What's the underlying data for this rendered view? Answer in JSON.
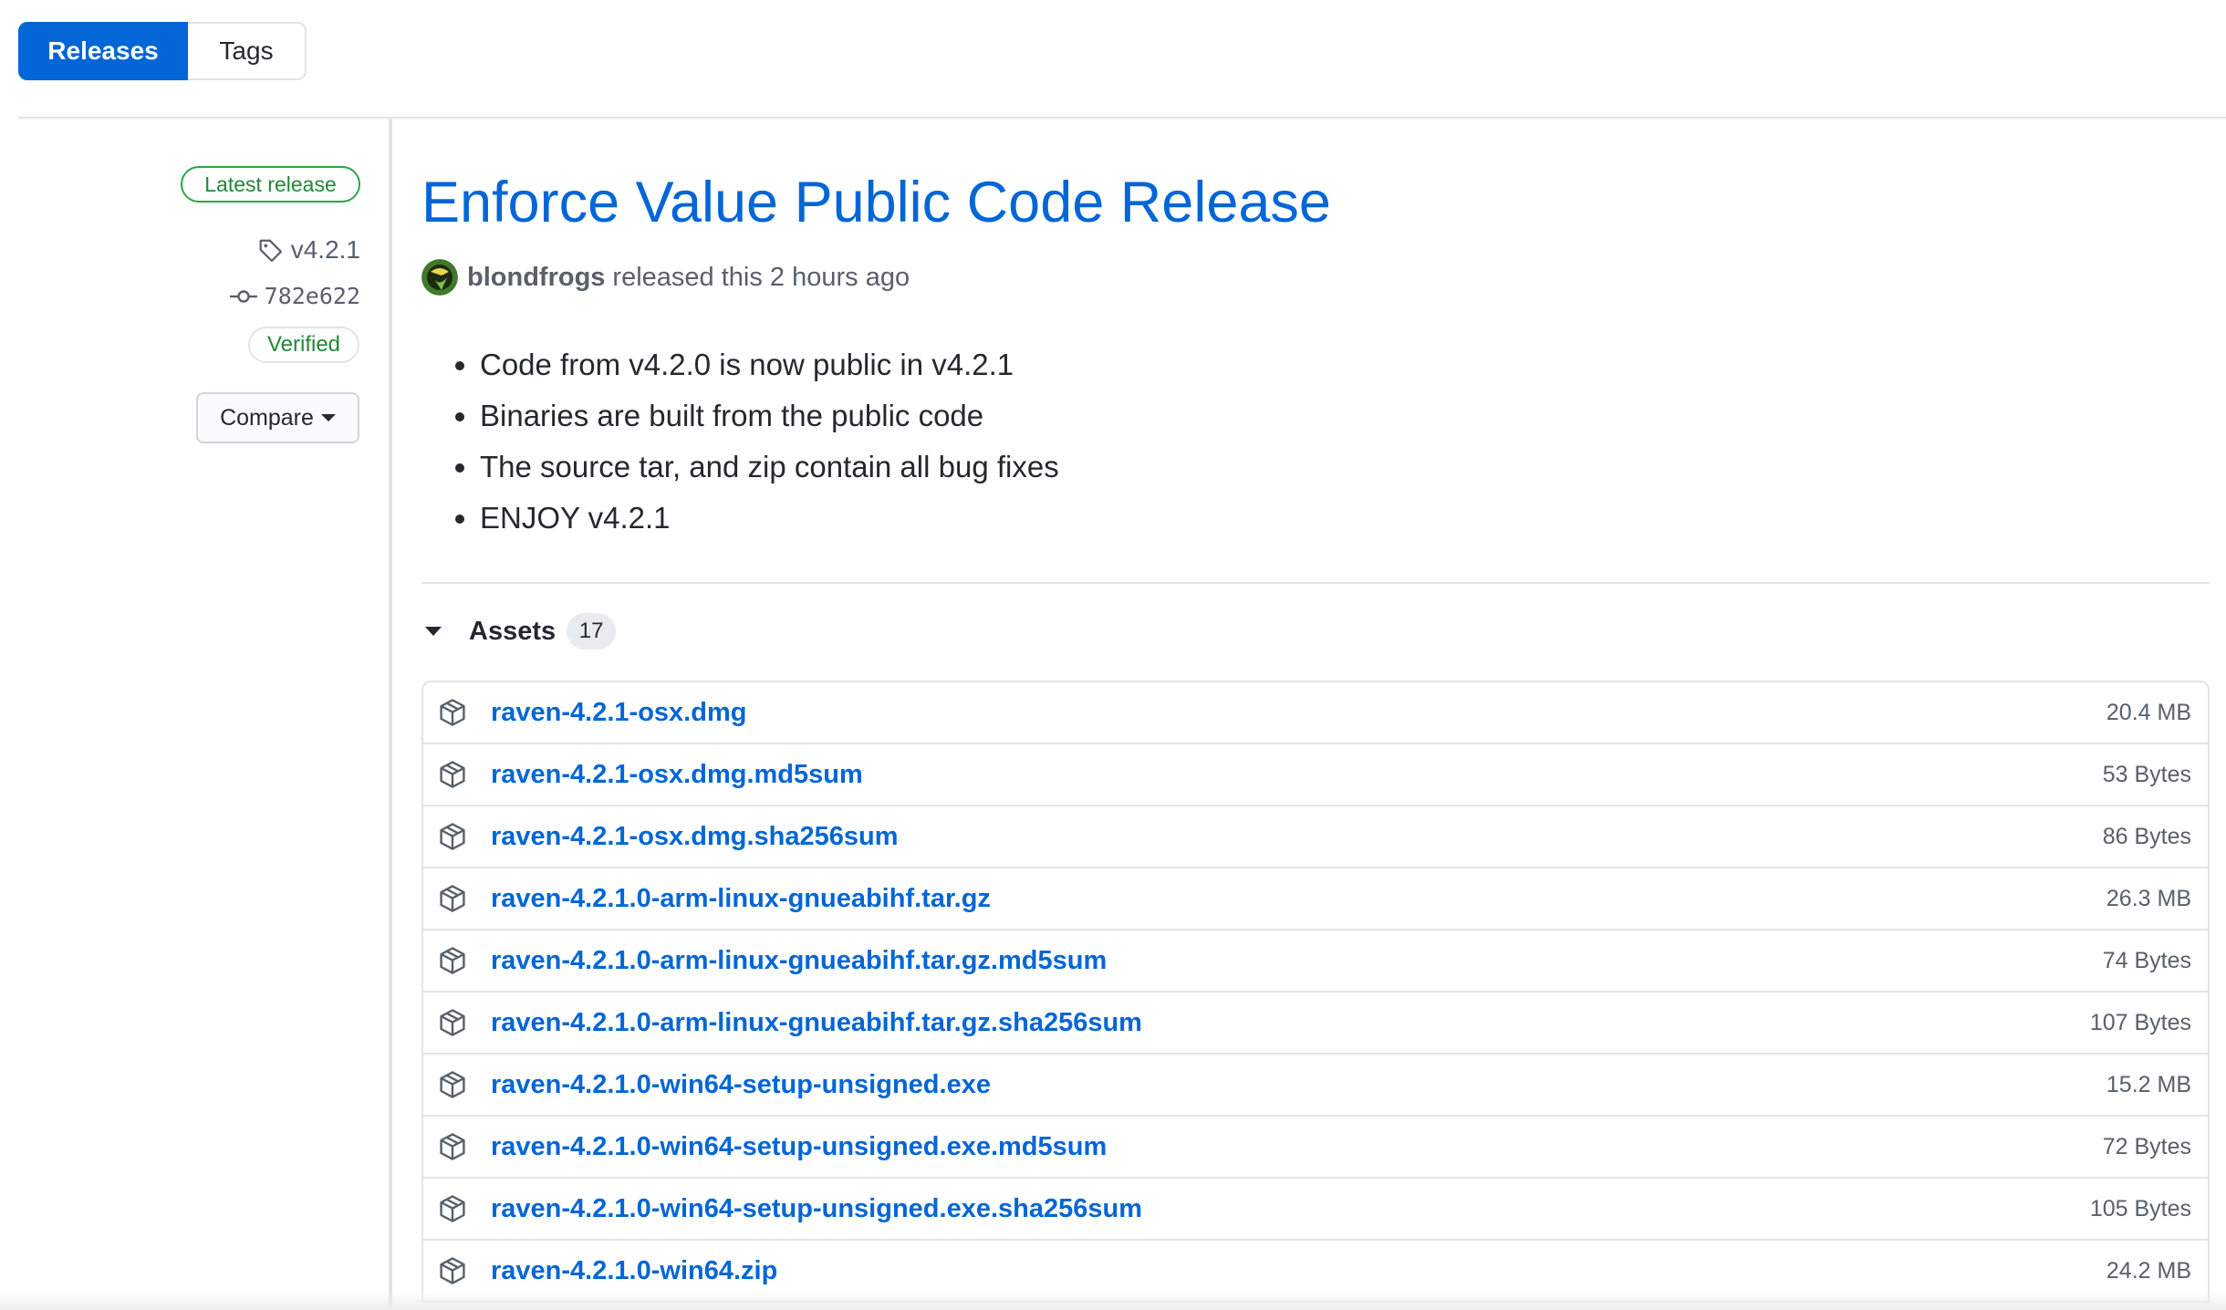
{
  "tabs": [
    {
      "label": "Releases",
      "active": true
    },
    {
      "label": "Tags",
      "active": false
    }
  ],
  "sidebar": {
    "latest_badge": "Latest release",
    "tag": "v4.2.1",
    "commit": "782e622",
    "verified": "Verified",
    "compare_label": "Compare"
  },
  "release": {
    "title": "Enforce Value Public Code Release",
    "author": "blondfrogs",
    "released_text": "released this 2 hours ago",
    "notes": [
      "Code from v4.2.0 is now public in v4.2.1",
      "Binaries are built from the public code",
      "The source tar, and zip contain all bug fixes",
      "ENJOY v4.2.1"
    ]
  },
  "assets": {
    "label": "Assets",
    "count": "17",
    "items": [
      {
        "name": "raven-4.2.1-osx.dmg",
        "size": "20.4 MB"
      },
      {
        "name": "raven-4.2.1-osx.dmg.md5sum",
        "size": "53 Bytes"
      },
      {
        "name": "raven-4.2.1-osx.dmg.sha256sum",
        "size": "86 Bytes"
      },
      {
        "name": "raven-4.2.1.0-arm-linux-gnueabihf.tar.gz",
        "size": "26.3 MB"
      },
      {
        "name": "raven-4.2.1.0-arm-linux-gnueabihf.tar.gz.md5sum",
        "size": "74 Bytes"
      },
      {
        "name": "raven-4.2.1.0-arm-linux-gnueabihf.tar.gz.sha256sum",
        "size": "107 Bytes"
      },
      {
        "name": "raven-4.2.1.0-win64-setup-unsigned.exe",
        "size": "15.2 MB"
      },
      {
        "name": "raven-4.2.1.0-win64-setup-unsigned.exe.md5sum",
        "size": "72 Bytes"
      },
      {
        "name": "raven-4.2.1.0-win64-setup-unsigned.exe.sha256sum",
        "size": "105 Bytes"
      },
      {
        "name": "raven-4.2.1.0-win64.zip",
        "size": "24.2 MB"
      }
    ]
  },
  "colors": {
    "accent": "#0366d6",
    "success": "#28a745",
    "muted": "#586069",
    "border": "#e1e4e8"
  },
  "icons": {
    "tag": "tag-icon",
    "commit": "git-commit-icon",
    "asset": "package-icon",
    "caret": "triangle-down-icon"
  }
}
